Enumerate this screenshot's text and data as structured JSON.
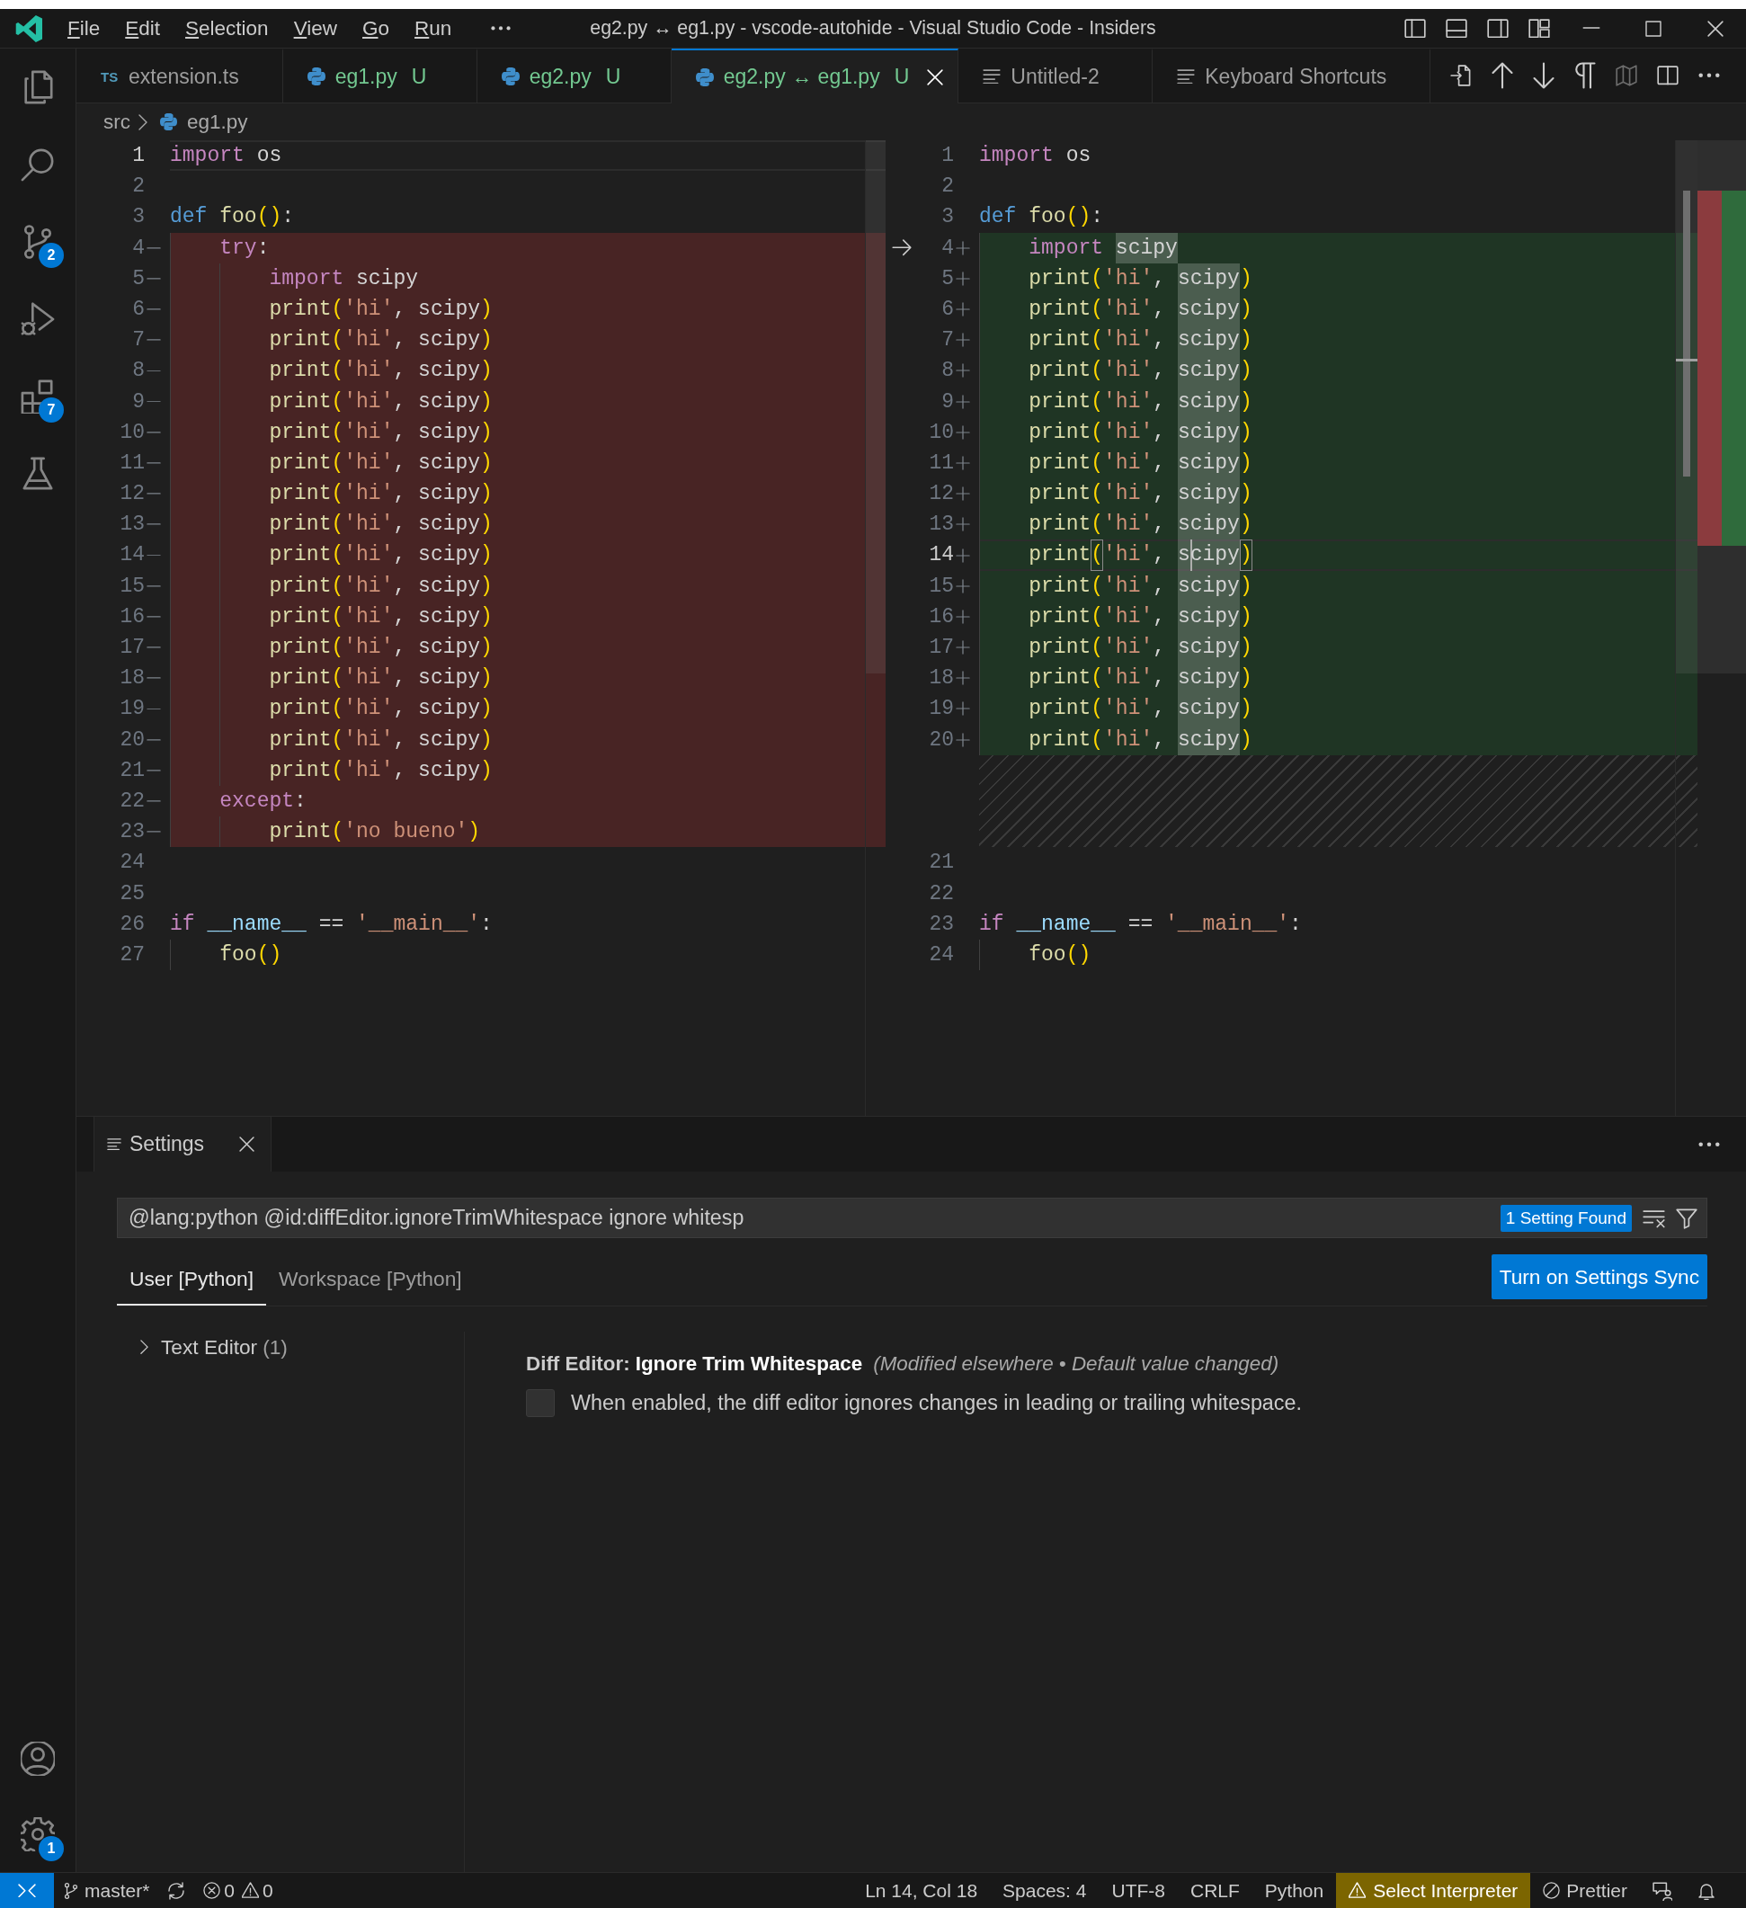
{
  "title_bar": {
    "menu": [
      {
        "label": "File"
      },
      {
        "label": "Edit"
      },
      {
        "label": "Selection"
      },
      {
        "label": "View"
      },
      {
        "label": "Go"
      },
      {
        "label": "Run"
      }
    ],
    "title": "eg2.py ↔ eg1.py - vscode-autohide - Visual Studio Code - Insiders"
  },
  "activity_bar": {
    "items": [
      {
        "kind": "explorer",
        "selected": false
      },
      {
        "kind": "search",
        "selected": false
      },
      {
        "kind": "source-control",
        "selected": false,
        "badge": "2"
      },
      {
        "kind": "run-debug",
        "selected": false
      },
      {
        "kind": "extensions",
        "selected": false,
        "badge": "7"
      },
      {
        "kind": "testing",
        "selected": false
      }
    ],
    "bottom_items": [
      {
        "kind": "accounts",
        "selected": false
      },
      {
        "kind": "manage",
        "selected": false,
        "badge": "1"
      }
    ]
  },
  "tabs": [
    {
      "kind": "typescript",
      "icon_text": "TS",
      "label": "extension.ts",
      "untracked": false,
      "selected": false
    },
    {
      "kind": "python",
      "label": "eg1.py",
      "git_status": "U",
      "untracked": true,
      "selected": false
    },
    {
      "kind": "python",
      "label": "eg2.py",
      "git_status": "U",
      "untracked": true,
      "selected": false
    },
    {
      "kind": "python",
      "label": "eg2.py ↔ eg1.py",
      "git_status": "U",
      "untracked": true,
      "selected": true
    },
    {
      "kind": "text",
      "label": "Untitled-2",
      "untracked": false,
      "selected": false
    },
    {
      "kind": "text",
      "label": "Keyboard Shortcuts",
      "untracked": false,
      "selected": false
    }
  ],
  "editor_actions": [
    {
      "kind": "open-file",
      "disabled": false
    },
    {
      "kind": "previous-change",
      "disabled": false
    },
    {
      "kind": "next-change",
      "disabled": false
    },
    {
      "kind": "whitespace",
      "disabled": false
    },
    {
      "kind": "inline-view",
      "disabled": true
    },
    {
      "kind": "split-editor",
      "disabled": false
    },
    {
      "kind": "more",
      "disabled": false
    }
  ],
  "breadcrumbs": [
    {
      "kind": "folder",
      "label": "src"
    },
    {
      "kind": "python",
      "label": "eg1.py"
    }
  ],
  "diff_editor": {
    "original": {
      "lines": [
        {
          "number": "1",
          "kind": "unchanged",
          "current": true,
          "tokens": [
            {
              "text": "import ",
              "kind": "keyword"
            },
            {
              "text": "os",
              "kind": "plain"
            }
          ]
        },
        {
          "number": "2",
          "kind": "unchanged",
          "current": false
        },
        {
          "number": "3",
          "kind": "unchanged",
          "current": false,
          "tokens": [
            {
              "text": "def ",
              "kind": "storage"
            },
            {
              "text": "foo",
              "kind": "function"
            },
            {
              "text": "()",
              "kind": "bracket"
            },
            {
              "text": ":",
              "kind": "plain"
            }
          ]
        },
        {
          "number": "4",
          "kind": "removed",
          "current": false,
          "tokens": [
            {
              "text": "    try",
              "kind": "keyword"
            },
            {
              "text": ":",
              "kind": "plain"
            }
          ]
        },
        {
          "number": "5",
          "kind": "removed",
          "current": false,
          "tokens": [
            {
              "text": "        import ",
              "kind": "keyword"
            },
            {
              "text": "scipy",
              "kind": "plain"
            }
          ]
        },
        {
          "number": "6",
          "kind": "removed",
          "current": false,
          "tokens": [
            {
              "text": "        print",
              "kind": "function"
            },
            {
              "text": "(",
              "kind": "bracket"
            },
            {
              "text": "'hi'",
              "kind": "string"
            },
            {
              "text": ", scipy",
              "kind": "plain"
            },
            {
              "text": ")",
              "kind": "bracket"
            }
          ]
        },
        {
          "number": "7",
          "kind": "removed",
          "current": false,
          "tokens": [
            {
              "text": "        print",
              "kind": "function"
            },
            {
              "text": "(",
              "kind": "bracket"
            },
            {
              "text": "'hi'",
              "kind": "string"
            },
            {
              "text": ", scipy",
              "kind": "plain"
            },
            {
              "text": ")",
              "kind": "bracket"
            }
          ]
        },
        {
          "number": "8",
          "kind": "removed",
          "current": false,
          "tokens": [
            {
              "text": "        print",
              "kind": "function"
            },
            {
              "text": "(",
              "kind": "bracket"
            },
            {
              "text": "'hi'",
              "kind": "string"
            },
            {
              "text": ", scipy",
              "kind": "plain"
            },
            {
              "text": ")",
              "kind": "bracket"
            }
          ]
        },
        {
          "number": "9",
          "kind": "removed",
          "current": false,
          "tokens": [
            {
              "text": "        print",
              "kind": "function"
            },
            {
              "text": "(",
              "kind": "bracket"
            },
            {
              "text": "'hi'",
              "kind": "string"
            },
            {
              "text": ", scipy",
              "kind": "plain"
            },
            {
              "text": ")",
              "kind": "bracket"
            }
          ]
        },
        {
          "number": "10",
          "kind": "removed",
          "current": false,
          "tokens": [
            {
              "text": "        print",
              "kind": "function"
            },
            {
              "text": "(",
              "kind": "bracket"
            },
            {
              "text": "'hi'",
              "kind": "string"
            },
            {
              "text": ", scipy",
              "kind": "plain"
            },
            {
              "text": ")",
              "kind": "bracket"
            }
          ]
        },
        {
          "number": "11",
          "kind": "removed",
          "current": false,
          "tokens": [
            {
              "text": "        print",
              "kind": "function"
            },
            {
              "text": "(",
              "kind": "bracket"
            },
            {
              "text": "'hi'",
              "kind": "string"
            },
            {
              "text": ", scipy",
              "kind": "plain"
            },
            {
              "text": ")",
              "kind": "bracket"
            }
          ]
        },
        {
          "number": "12",
          "kind": "removed",
          "current": false,
          "tokens": [
            {
              "text": "        print",
              "kind": "function"
            },
            {
              "text": "(",
              "kind": "bracket"
            },
            {
              "text": "'hi'",
              "kind": "string"
            },
            {
              "text": ", scipy",
              "kind": "plain"
            },
            {
              "text": ")",
              "kind": "bracket"
            }
          ]
        },
        {
          "number": "13",
          "kind": "removed",
          "current": false,
          "tokens": [
            {
              "text": "        print",
              "kind": "function"
            },
            {
              "text": "(",
              "kind": "bracket"
            },
            {
              "text": "'hi'",
              "kind": "string"
            },
            {
              "text": ", scipy",
              "kind": "plain"
            },
            {
              "text": ")",
              "kind": "bracket"
            }
          ]
        },
        {
          "number": "14",
          "kind": "removed",
          "current": false,
          "tokens": [
            {
              "text": "        print",
              "kind": "function"
            },
            {
              "text": "(",
              "kind": "bracket"
            },
            {
              "text": "'hi'",
              "kind": "string"
            },
            {
              "text": ", scipy",
              "kind": "plain"
            },
            {
              "text": ")",
              "kind": "bracket"
            }
          ]
        },
        {
          "number": "15",
          "kind": "removed",
          "current": false,
          "tokens": [
            {
              "text": "        print",
              "kind": "function"
            },
            {
              "text": "(",
              "kind": "bracket"
            },
            {
              "text": "'hi'",
              "kind": "string"
            },
            {
              "text": ", scipy",
              "kind": "plain"
            },
            {
              "text": ")",
              "kind": "bracket"
            }
          ]
        },
        {
          "number": "16",
          "kind": "removed",
          "current": false,
          "tokens": [
            {
              "text": "        print",
              "kind": "function"
            },
            {
              "text": "(",
              "kind": "bracket"
            },
            {
              "text": "'hi'",
              "kind": "string"
            },
            {
              "text": ", scipy",
              "kind": "plain"
            },
            {
              "text": ")",
              "kind": "bracket"
            }
          ]
        },
        {
          "number": "17",
          "kind": "removed",
          "current": false,
          "tokens": [
            {
              "text": "        print",
              "kind": "function"
            },
            {
              "text": "(",
              "kind": "bracket"
            },
            {
              "text": "'hi'",
              "kind": "string"
            },
            {
              "text": ", scipy",
              "kind": "plain"
            },
            {
              "text": ")",
              "kind": "bracket"
            }
          ]
        },
        {
          "number": "18",
          "kind": "removed",
          "current": false,
          "tokens": [
            {
              "text": "        print",
              "kind": "function"
            },
            {
              "text": "(",
              "kind": "bracket"
            },
            {
              "text": "'hi'",
              "kind": "string"
            },
            {
              "text": ", scipy",
              "kind": "plain"
            },
            {
              "text": ")",
              "kind": "bracket"
            }
          ]
        },
        {
          "number": "19",
          "kind": "removed",
          "current": false,
          "tokens": [
            {
              "text": "        print",
              "kind": "function"
            },
            {
              "text": "(",
              "kind": "bracket"
            },
            {
              "text": "'hi'",
              "kind": "string"
            },
            {
              "text": ", scipy",
              "kind": "plain"
            },
            {
              "text": ")",
              "kind": "bracket"
            }
          ]
        },
        {
          "number": "20",
          "kind": "removed",
          "current": false,
          "tokens": [
            {
              "text": "        print",
              "kind": "function"
            },
            {
              "text": "(",
              "kind": "bracket"
            },
            {
              "text": "'hi'",
              "kind": "string"
            },
            {
              "text": ", scipy",
              "kind": "plain"
            },
            {
              "text": ")",
              "kind": "bracket"
            }
          ]
        },
        {
          "number": "21",
          "kind": "removed",
          "current": false,
          "tokens": [
            {
              "text": "        print",
              "kind": "function"
            },
            {
              "text": "(",
              "kind": "bracket"
            },
            {
              "text": "'hi'",
              "kind": "string"
            },
            {
              "text": ", scipy",
              "kind": "plain"
            },
            {
              "text": ")",
              "kind": "bracket"
            }
          ]
        },
        {
          "number": "22",
          "kind": "removed",
          "current": false,
          "tokens": [
            {
              "text": "    except",
              "kind": "keyword"
            },
            {
              "text": ":",
              "kind": "plain"
            }
          ]
        },
        {
          "number": "23",
          "kind": "removed",
          "current": false,
          "tokens": [
            {
              "text": "        print",
              "kind": "function"
            },
            {
              "text": "(",
              "kind": "bracket"
            },
            {
              "text": "'no bueno'",
              "kind": "string"
            },
            {
              "text": ")",
              "kind": "bracket"
            }
          ]
        },
        {
          "number": "24",
          "kind": "unchanged",
          "current": false
        },
        {
          "number": "25",
          "kind": "unchanged",
          "current": false
        },
        {
          "number": "26",
          "kind": "unchanged",
          "current": false,
          "tokens": [
            {
              "text": "if ",
              "kind": "keyword"
            },
            {
              "text": "__name__",
              "kind": "variable"
            },
            {
              "text": " == ",
              "kind": "plain"
            },
            {
              "text": "'__main__'",
              "kind": "string"
            },
            {
              "text": ":",
              "kind": "plain"
            }
          ]
        },
        {
          "number": "27",
          "kind": "unchanged",
          "current": false,
          "tokens": [
            {
              "text": "    foo",
              "kind": "function"
            },
            {
              "text": "()",
              "kind": "bracket"
            }
          ]
        }
      ]
    },
    "modified": {
      "lines": [
        {
          "number": "1",
          "kind": "unchanged",
          "current": false,
          "tokens": [
            {
              "text": "import ",
              "kind": "keyword"
            },
            {
              "text": "os",
              "kind": "plain"
            }
          ]
        },
        {
          "number": "2",
          "kind": "unchanged",
          "current": false
        },
        {
          "number": "3",
          "kind": "unchanged",
          "current": false,
          "tokens": [
            {
              "text": "def ",
              "kind": "storage"
            },
            {
              "text": "foo",
              "kind": "function"
            },
            {
              "text": "()",
              "kind": "bracket"
            },
            {
              "text": ":",
              "kind": "plain"
            }
          ]
        },
        {
          "number": "4",
          "kind": "inserted",
          "current": false,
          "revert_arrow": true,
          "tokens": [
            {
              "text": "    import ",
              "kind": "keyword"
            },
            {
              "text": "scipy",
              "kind": "plain",
              "highlighted": true
            }
          ]
        },
        {
          "number": "5",
          "kind": "inserted",
          "current": false,
          "tokens": [
            {
              "text": "    print",
              "kind": "function"
            },
            {
              "text": "(",
              "kind": "bracket"
            },
            {
              "text": "'hi'",
              "kind": "string"
            },
            {
              "text": ", ",
              "kind": "plain"
            },
            {
              "text": "scipy",
              "kind": "plain",
              "highlighted": true
            },
            {
              "text": ")",
              "kind": "bracket"
            }
          ]
        },
        {
          "number": "6",
          "kind": "inserted",
          "current": false,
          "tokens": [
            {
              "text": "    print",
              "kind": "function"
            },
            {
              "text": "(",
              "kind": "bracket"
            },
            {
              "text": "'hi'",
              "kind": "string"
            },
            {
              "text": ", ",
              "kind": "plain"
            },
            {
              "text": "scipy",
              "kind": "plain",
              "highlighted": true
            },
            {
              "text": ")",
              "kind": "bracket"
            }
          ]
        },
        {
          "number": "7",
          "kind": "inserted",
          "current": false,
          "tokens": [
            {
              "text": "    print",
              "kind": "function"
            },
            {
              "text": "(",
              "kind": "bracket"
            },
            {
              "text": "'hi'",
              "kind": "string"
            },
            {
              "text": ", ",
              "kind": "plain"
            },
            {
              "text": "scipy",
              "kind": "plain",
              "highlighted": true
            },
            {
              "text": ")",
              "kind": "bracket"
            }
          ]
        },
        {
          "number": "8",
          "kind": "inserted",
          "current": false,
          "tokens": [
            {
              "text": "    print",
              "kind": "function"
            },
            {
              "text": "(",
              "kind": "bracket"
            },
            {
              "text": "'hi'",
              "kind": "string"
            },
            {
              "text": ", ",
              "kind": "plain"
            },
            {
              "text": "scipy",
              "kind": "plain",
              "highlighted": true
            },
            {
              "text": ")",
              "kind": "bracket"
            }
          ]
        },
        {
          "number": "9",
          "kind": "inserted",
          "current": false,
          "tokens": [
            {
              "text": "    print",
              "kind": "function"
            },
            {
              "text": "(",
              "kind": "bracket"
            },
            {
              "text": "'hi'",
              "kind": "string"
            },
            {
              "text": ", ",
              "kind": "plain"
            },
            {
              "text": "scipy",
              "kind": "plain",
              "highlighted": true
            },
            {
              "text": ")",
              "kind": "bracket"
            }
          ]
        },
        {
          "number": "10",
          "kind": "inserted",
          "current": false,
          "tokens": [
            {
              "text": "    print",
              "kind": "function"
            },
            {
              "text": "(",
              "kind": "bracket"
            },
            {
              "text": "'hi'",
              "kind": "string"
            },
            {
              "text": ", ",
              "kind": "plain"
            },
            {
              "text": "scipy",
              "kind": "plain",
              "highlighted": true
            },
            {
              "text": ")",
              "kind": "bracket"
            }
          ]
        },
        {
          "number": "11",
          "kind": "inserted",
          "current": false,
          "tokens": [
            {
              "text": "    print",
              "kind": "function"
            },
            {
              "text": "(",
              "kind": "bracket"
            },
            {
              "text": "'hi'",
              "kind": "string"
            },
            {
              "text": ", ",
              "kind": "plain"
            },
            {
              "text": "scipy",
              "kind": "plain",
              "highlighted": true
            },
            {
              "text": ")",
              "kind": "bracket"
            }
          ]
        },
        {
          "number": "12",
          "kind": "inserted",
          "current": false,
          "tokens": [
            {
              "text": "    print",
              "kind": "function"
            },
            {
              "text": "(",
              "kind": "bracket"
            },
            {
              "text": "'hi'",
              "kind": "string"
            },
            {
              "text": ", ",
              "kind": "plain"
            },
            {
              "text": "scipy",
              "kind": "plain",
              "highlighted": true
            },
            {
              "text": ")",
              "kind": "bracket"
            }
          ]
        },
        {
          "number": "13",
          "kind": "inserted",
          "current": false,
          "tokens": [
            {
              "text": "    print",
              "kind": "function"
            },
            {
              "text": "(",
              "kind": "bracket"
            },
            {
              "text": "'hi'",
              "kind": "string"
            },
            {
              "text": ", ",
              "kind": "plain"
            },
            {
              "text": "scipy",
              "kind": "plain",
              "highlighted": true
            },
            {
              "text": ")",
              "kind": "bracket"
            }
          ]
        },
        {
          "number": "14",
          "kind": "inserted",
          "current": true,
          "tokens": [
            {
              "text": "    print",
              "kind": "function"
            },
            {
              "text": "(",
              "kind": "bracket",
              "bracket_match": true
            },
            {
              "text": "'hi'",
              "kind": "string"
            },
            {
              "text": ", ",
              "kind": "plain"
            },
            {
              "text": "s",
              "kind": "plain",
              "highlighted": true
            },
            {
              "text": "cipy",
              "kind": "plain",
              "highlighted": true,
              "cursor": true
            },
            {
              "text": ")",
              "kind": "bracket",
              "bracket_match": true
            }
          ]
        },
        {
          "number": "15",
          "kind": "inserted",
          "current": false,
          "tokens": [
            {
              "text": "    print",
              "kind": "function"
            },
            {
              "text": "(",
              "kind": "bracket"
            },
            {
              "text": "'hi'",
              "kind": "string"
            },
            {
              "text": ", ",
              "kind": "plain"
            },
            {
              "text": "scipy",
              "kind": "plain",
              "highlighted": true
            },
            {
              "text": ")",
              "kind": "bracket"
            }
          ]
        },
        {
          "number": "16",
          "kind": "inserted",
          "current": false,
          "tokens": [
            {
              "text": "    print",
              "kind": "function"
            },
            {
              "text": "(",
              "kind": "bracket"
            },
            {
              "text": "'hi'",
              "kind": "string"
            },
            {
              "text": ", ",
              "kind": "plain"
            },
            {
              "text": "scipy",
              "kind": "plain",
              "highlighted": true
            },
            {
              "text": ")",
              "kind": "bracket"
            }
          ]
        },
        {
          "number": "17",
          "kind": "inserted",
          "current": false,
          "tokens": [
            {
              "text": "    print",
              "kind": "function"
            },
            {
              "text": "(",
              "kind": "bracket"
            },
            {
              "text": "'hi'",
              "kind": "string"
            },
            {
              "text": ", ",
              "kind": "plain"
            },
            {
              "text": "scipy",
              "kind": "plain",
              "highlighted": true
            },
            {
              "text": ")",
              "kind": "bracket"
            }
          ]
        },
        {
          "number": "18",
          "kind": "inserted",
          "current": false,
          "tokens": [
            {
              "text": "    print",
              "kind": "function"
            },
            {
              "text": "(",
              "kind": "bracket"
            },
            {
              "text": "'hi'",
              "kind": "string"
            },
            {
              "text": ", ",
              "kind": "plain"
            },
            {
              "text": "scipy",
              "kind": "plain",
              "highlighted": true
            },
            {
              "text": ")",
              "kind": "bracket"
            }
          ]
        },
        {
          "number": "19",
          "kind": "inserted",
          "current": false,
          "tokens": [
            {
              "text": "    print",
              "kind": "function"
            },
            {
              "text": "(",
              "kind": "bracket"
            },
            {
              "text": "'hi'",
              "kind": "string"
            },
            {
              "text": ", ",
              "kind": "plain"
            },
            {
              "text": "scipy",
              "kind": "plain",
              "highlighted": true
            },
            {
              "text": ")",
              "kind": "bracket"
            }
          ]
        },
        {
          "number": "20",
          "kind": "inserted",
          "current": false,
          "tokens": [
            {
              "text": "    print",
              "kind": "function"
            },
            {
              "text": "(",
              "kind": "bracket"
            },
            {
              "text": "'hi'",
              "kind": "string"
            },
            {
              "text": ", ",
              "kind": "plain"
            },
            {
              "text": "scipy",
              "kind": "plain",
              "highlighted": true
            },
            {
              "text": ")",
              "kind": "bracket"
            }
          ]
        },
        {
          "kind": "filler"
        },
        {
          "kind": "filler"
        },
        {
          "kind": "filler"
        },
        {
          "number": "21",
          "kind": "unchanged",
          "current": false
        },
        {
          "number": "22",
          "kind": "unchanged",
          "current": false
        },
        {
          "number": "23",
          "kind": "unchanged",
          "current": false,
          "tokens": [
            {
              "text": "if ",
              "kind": "keyword"
            },
            {
              "text": "__name__",
              "kind": "variable"
            },
            {
              "text": " == ",
              "kind": "plain"
            },
            {
              "text": "'__main__'",
              "kind": "string"
            },
            {
              "text": ":",
              "kind": "plain"
            }
          ]
        },
        {
          "number": "24",
          "kind": "unchanged",
          "current": false,
          "tokens": [
            {
              "text": "    foo",
              "kind": "function"
            },
            {
              "text": "()",
              "kind": "bracket"
            }
          ]
        }
      ]
    }
  },
  "panel": {
    "tabs": [
      {
        "label": "Settings",
        "selected": true
      }
    ],
    "settings": {
      "search": {
        "value": "@lang:python @id:diffEditor.ignoreTrimWhitespace ignore whitesp"
      },
      "result_count": "1 Setting Found",
      "scope_tabs": [
        {
          "label": "User [Python]",
          "selected": true
        },
        {
          "label": "Workspace [Python]",
          "selected": false
        }
      ],
      "sync_button": {
        "label": "Turn on Settings Sync"
      },
      "toc": [
        {
          "label": "Text Editor",
          "count": "(1)",
          "expanded": false
        }
      ],
      "items": [
        {
          "kind": "checkbox",
          "category": "Diff Editor:",
          "label": "Ignore Trim Whitespace",
          "indicator": "(Modified elsewhere • Default value changed)",
          "checked": false,
          "description": "When enabled, the diff editor ignores changes in leading or trailing whitespace."
        }
      ]
    }
  },
  "status_bar": {
    "left": [
      {
        "kind": "remote"
      },
      {
        "kind": "branch",
        "label": "master*"
      },
      {
        "kind": "sync"
      },
      {
        "kind": "problems",
        "errors": "0",
        "warnings": "0"
      }
    ],
    "right": [
      {
        "kind": "text",
        "label": "Ln 14, Col 18"
      },
      {
        "kind": "text",
        "label": "Spaces: 4"
      },
      {
        "kind": "text",
        "label": "UTF-8"
      },
      {
        "kind": "text",
        "label": "CRLF"
      },
      {
        "kind": "text",
        "label": "Python"
      },
      {
        "kind": "warning",
        "label": "Select Interpreter"
      },
      {
        "kind": "prettier",
        "label": "Prettier"
      },
      {
        "kind": "feedback"
      },
      {
        "kind": "notifications"
      }
    ]
  }
}
